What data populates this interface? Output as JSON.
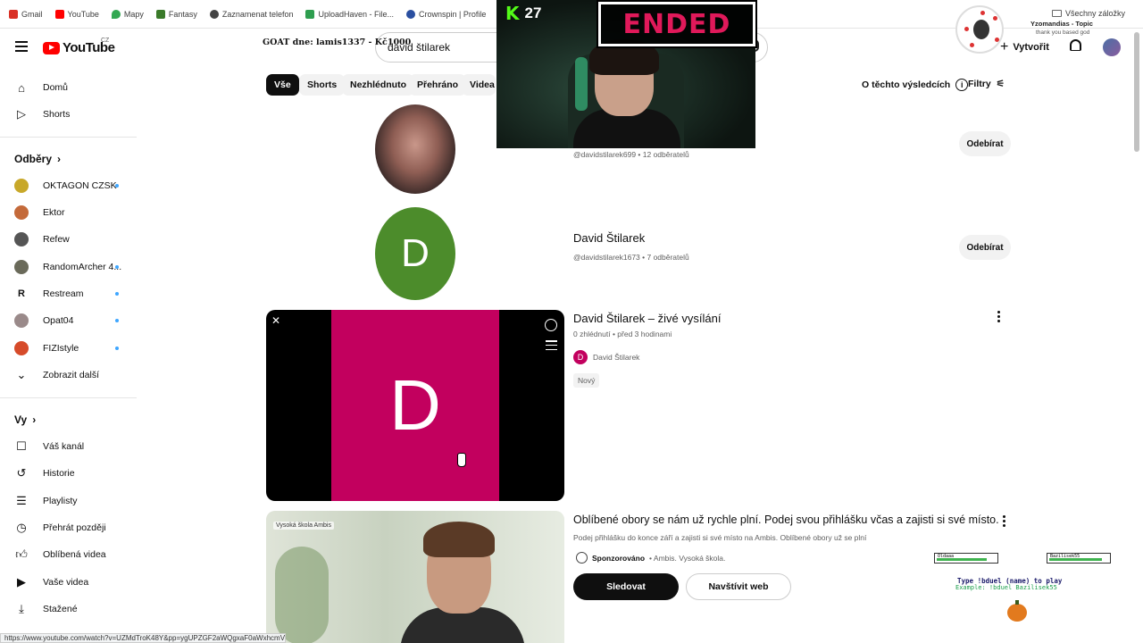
{
  "bookmarks": [
    {
      "label": "Gmail",
      "color": "#d93025"
    },
    {
      "label": "YouTube",
      "color": "#ff0000"
    },
    {
      "label": "Mapy",
      "color": "#34a853"
    },
    {
      "label": "Fantasy",
      "color": "#3a7a2a"
    },
    {
      "label": "Zaznamenat telefon",
      "color": "#444444"
    },
    {
      "label": "UploadHaven - File...",
      "color": "#2e9e4f"
    },
    {
      "label": "Crownspin | Profile",
      "color": "#2a4fa0"
    }
  ],
  "bookmarks_right": "Všechny záložky",
  "header": {
    "logo": "YouTube",
    "country": "CZ",
    "goat": "GOAT dne: lamis1337 - Kč1000",
    "search_value": "david štilarek",
    "create_label": "Vytvořit"
  },
  "stream": {
    "platform_letter": "K",
    "viewers": "27",
    "status": "ENDED"
  },
  "notification": {
    "title": "Yzomandias - Topic",
    "subtitle": "thank you based god"
  },
  "sidebar": {
    "main": [
      {
        "label": "Domů",
        "icon": "home-icon"
      },
      {
        "label": "Shorts",
        "icon": "shorts-icon"
      }
    ],
    "subscriptions_title": "Odběry",
    "subscriptions": [
      {
        "label": "OKTAGON CZSK",
        "color": "#c8a82a",
        "live": true
      },
      {
        "label": "Ektor",
        "color": "#c46a3a",
        "live": false
      },
      {
        "label": "Refew",
        "color": "#555555",
        "live": false
      },
      {
        "label": "RandomArcher 4...",
        "color": "#6a6a5a",
        "live": true
      },
      {
        "label": "Restream",
        "color": "#111111",
        "live": true
      },
      {
        "label": "Opat04",
        "color": "#9a8a8a",
        "live": true
      },
      {
        "label": "FIZIstyle",
        "color": "#d64b2a",
        "live": true
      }
    ],
    "show_more": "Zobrazit další",
    "you_title": "Vy",
    "you": [
      {
        "label": "Váš kanál",
        "icon": "channel-icon"
      },
      {
        "label": "Historie",
        "icon": "history-icon"
      },
      {
        "label": "Playlisty",
        "icon": "playlist-icon"
      },
      {
        "label": "Přehrát později",
        "icon": "watch-later-icon"
      },
      {
        "label": "Oblíbená videa",
        "icon": "like-icon"
      },
      {
        "label": "Vaše videa",
        "icon": "your-videos-icon"
      },
      {
        "label": "Stažené",
        "icon": "download-icon"
      }
    ]
  },
  "chips": [
    "Vše",
    "Shorts",
    "Nezhlédnuto",
    "Přehráno",
    "Videa"
  ],
  "results_info": "O těchto výsledcích",
  "filters": "Filtry",
  "results": {
    "channel1": {
      "meta": "@davidstilarek699 • 12 odběratelů",
      "button": "Odebírat"
    },
    "channel2": {
      "initial": "D",
      "title": "David Štilarek",
      "meta": "@davidstilarek1673 • 7 odběratelů",
      "button": "Odebírat"
    },
    "live": {
      "initial": "D",
      "title": "David Štilarek – živé vysílání",
      "meta": "0 zhlédnutí • před 3 hodinami",
      "channel": "David Štilarek",
      "badge": "Nový"
    },
    "ad": {
      "thumb_label": "Vysoká škola Ambis",
      "title": "Oblíbené obory se nám už rychle plní. Podej svou přihlášku včas a zajisti si své místo.",
      "desc": "Podej přihlášku do konce září a zajisti si své místo na Ambis. Oblíbené obory už se plní",
      "sponsored": "Sponzorováno",
      "sponsor": "• Ambis. Vysoká škola.",
      "btn_follow": "Sledovat",
      "btn_visit": "Navštívit web"
    }
  },
  "game": {
    "player1": "Oldaaa",
    "player2": "Bazilisek55",
    "player1_hp": 0.85,
    "player2_hp": 0.9,
    "line1": "Type !bduel (name) to play",
    "line2": "Example: !bduel Bazilisek55"
  },
  "status_url": "https://www.youtube.com/watch?v=UZMdTroK48Y&pp=ygUPZGF2aWQgxaF0aWxhcmVr"
}
